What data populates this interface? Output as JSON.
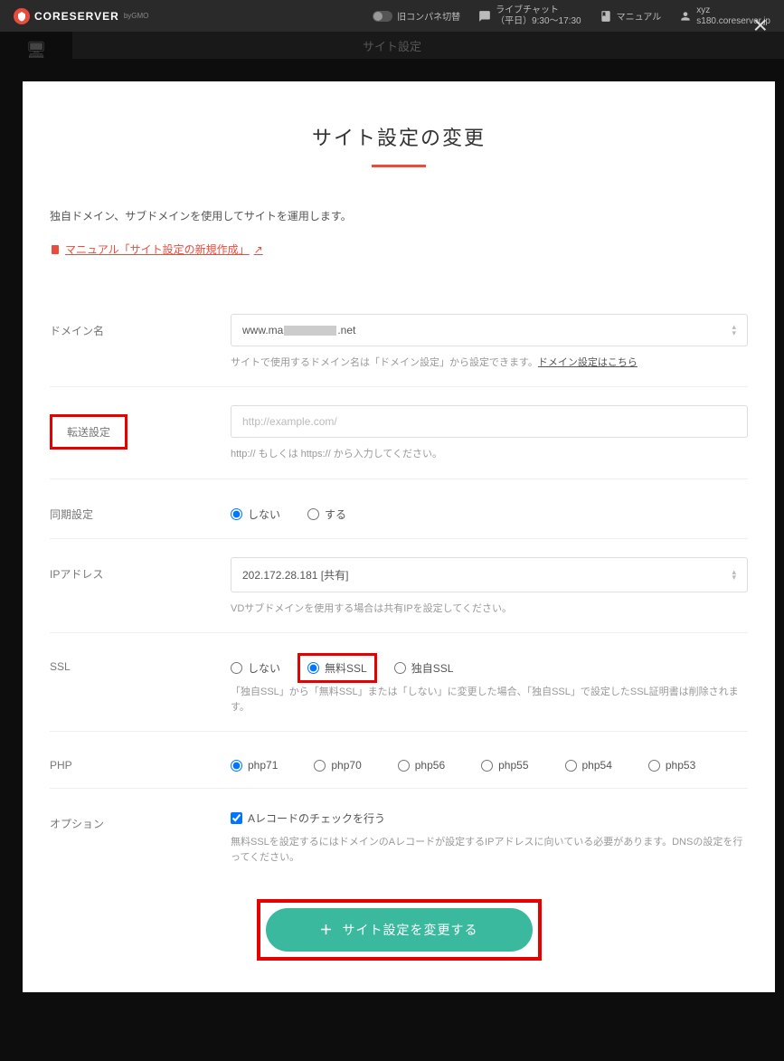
{
  "header": {
    "logo": "CORESERVER",
    "logo_sub": "byGMO",
    "old_panel": "旧コンパネ切替",
    "livechat_title": "ライブチャット",
    "livechat_hours": "（平日）9:30～17:30",
    "manual": "マニュアル",
    "user": "xyz",
    "server": "s180.coreserver.jp"
  },
  "sub_header": "サイト設定",
  "close_glyph": "×",
  "modal": {
    "title": "サイト設定の変更",
    "desc": "独自ドメイン、サブドメインを使用してサイトを運用します。",
    "manual_link": "マニュアル「サイト設定の新規作成」 ",
    "manual_link_icon": "↗"
  },
  "form": {
    "domain": {
      "label": "ドメイン名",
      "value_prefix": "www.ma",
      "value_suffix": ".net",
      "help_pre": "サイトで使用するドメイン名は「ドメイン設定」から設定できます。",
      "help_link": "ドメイン設定はこちら"
    },
    "redirect": {
      "label": "転送設定",
      "placeholder": "http://example.com/",
      "help": "http:// もしくは https:// から入力してください。"
    },
    "sync": {
      "label": "同期設定",
      "opt_no": "しない",
      "opt_yes": "する"
    },
    "ip": {
      "label": "IPアドレス",
      "value": "202.172.28.181 [共有]",
      "help": "VDサブドメインを使用する場合は共有IPを設定してください。"
    },
    "ssl": {
      "label": "SSL",
      "opt_no": "しない",
      "opt_free": "無料SSL",
      "opt_own": "独自SSL",
      "help": "「独自SSL」から「無料SSL」または「しない」に変更した場合、「独自SSL」で設定したSSL証明書は削除されます。"
    },
    "php": {
      "label": "PHP",
      "opts": [
        "php71",
        "php70",
        "php56",
        "php55",
        "php54",
        "php53"
      ]
    },
    "option": {
      "label": "オプション",
      "checkbox": "Aレコードのチェックを行う",
      "help": "無料SSLを設定するにはドメインのAレコードが設定するIPアドレスに向いている必要があります。DNSの設定を行ってください。"
    },
    "submit": "サイト設定を変更する"
  }
}
